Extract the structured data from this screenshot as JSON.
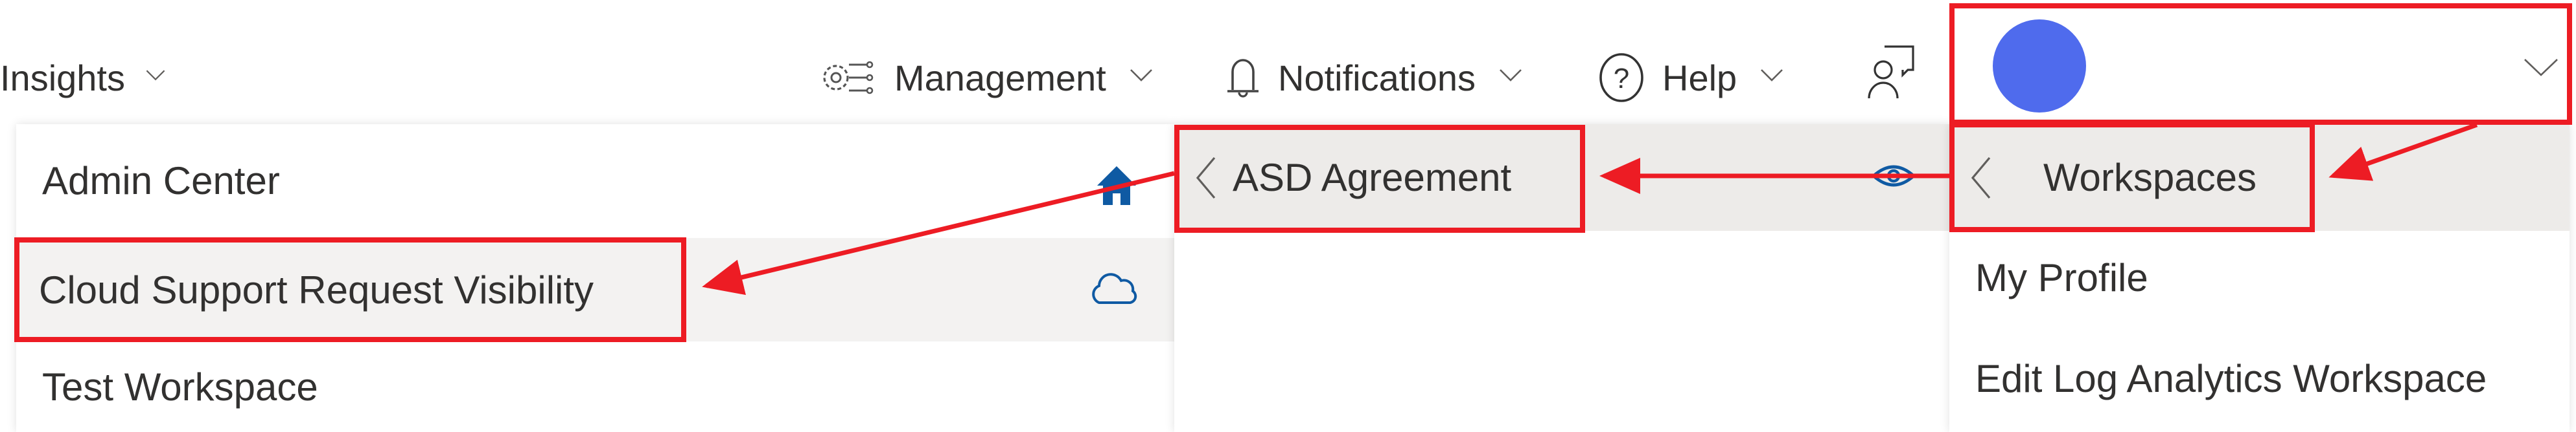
{
  "topnav": {
    "items": [
      {
        "label": "Insights",
        "icon": "none"
      },
      {
        "label": "Management",
        "icon": "gear-settings-icon"
      },
      {
        "label": "Notifications",
        "icon": "bell-icon"
      },
      {
        "label": "Help",
        "icon": "question-circle-icon"
      }
    ],
    "feedback_icon": "person-feedback-icon",
    "avatar_color": "#4f6bed"
  },
  "left_menu": {
    "items": [
      {
        "label": "Admin Center",
        "icon": "home-icon"
      },
      {
        "label": "Cloud Support Request Visibility",
        "icon": "cloud-icon",
        "highlighted": true
      },
      {
        "label": "Test Workspace",
        "icon": "none"
      }
    ]
  },
  "mid_menu": {
    "header": {
      "label": "ASD Agreement",
      "back_icon": "chevron-left-icon",
      "icon": "eye-icon"
    }
  },
  "right_menu": {
    "header": {
      "label": "Workspaces",
      "back_icon": "chevron-left-icon"
    },
    "items": [
      {
        "label": "My Profile"
      },
      {
        "label": "Edit Log Analytics Workspace"
      }
    ]
  },
  "colors": {
    "annotation": "#ed1c24",
    "icon_blue": "#0f5aa3",
    "avatar": "#4f6bed",
    "row_highlight": "#f3f2f1",
    "header_gray": "#edebe9"
  }
}
